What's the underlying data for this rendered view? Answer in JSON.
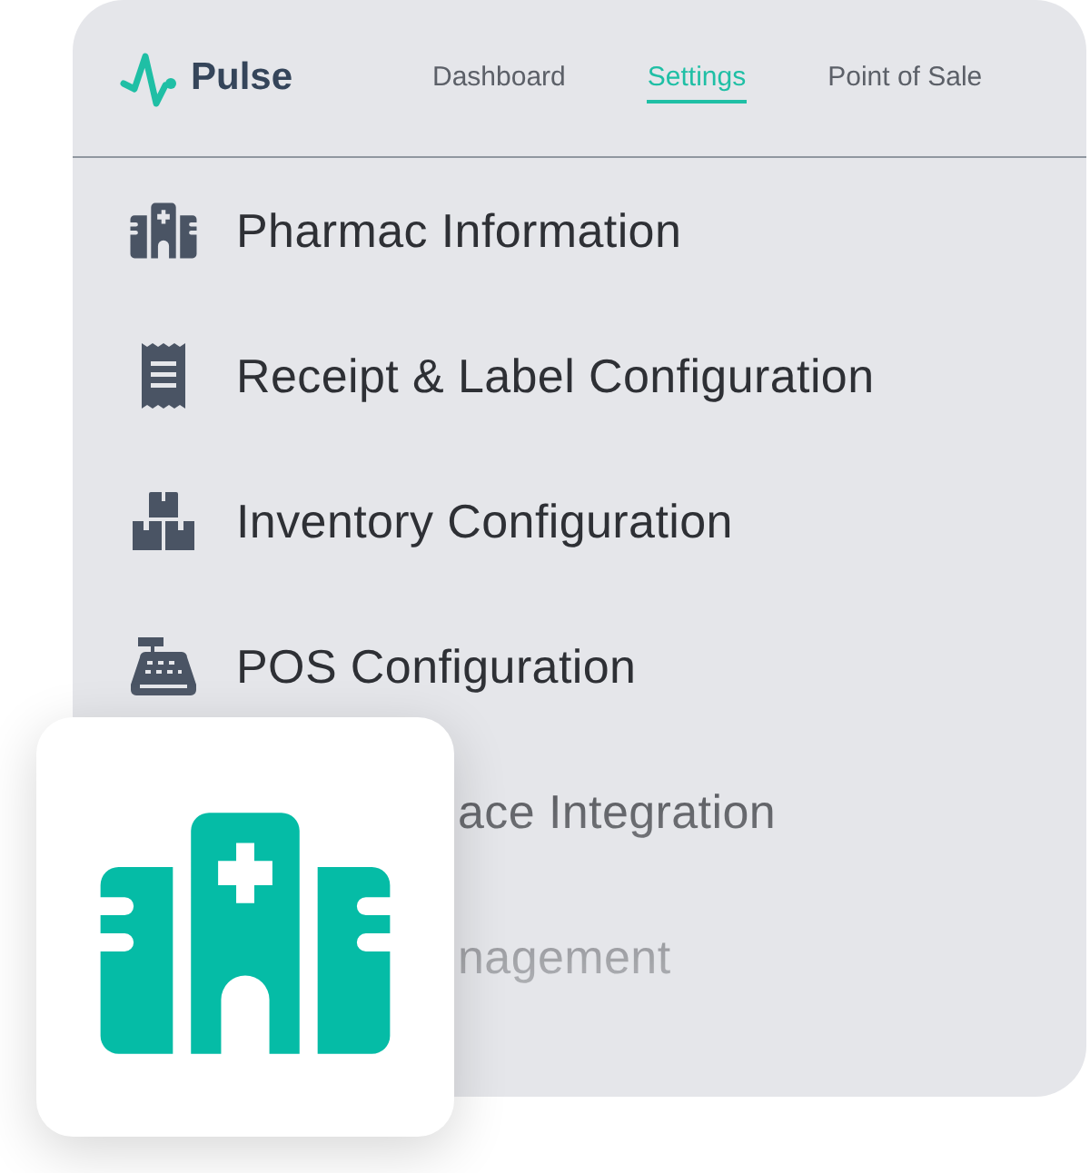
{
  "brand": {
    "name": "Pulse"
  },
  "nav": [
    {
      "label": "Dashboard",
      "selected": false
    },
    {
      "label": "Settings",
      "selected": true
    },
    {
      "label": "Point of Sale",
      "selected": false
    }
  ],
  "menu": [
    {
      "label": "Pharmac Information",
      "kind": "hospital",
      "covered": false
    },
    {
      "label": "Receipt & Label Configuration",
      "kind": "receipt",
      "covered": false
    },
    {
      "label": "Inventory Configuration",
      "kind": "boxes",
      "covered": false
    },
    {
      "label": "POS Configuration",
      "kind": "register",
      "covered": false
    },
    {
      "label": "ace Integration",
      "covered": true
    },
    {
      "label": "nagement",
      "covered": true
    }
  ],
  "feature_card": {
    "kind": "hospital"
  }
}
